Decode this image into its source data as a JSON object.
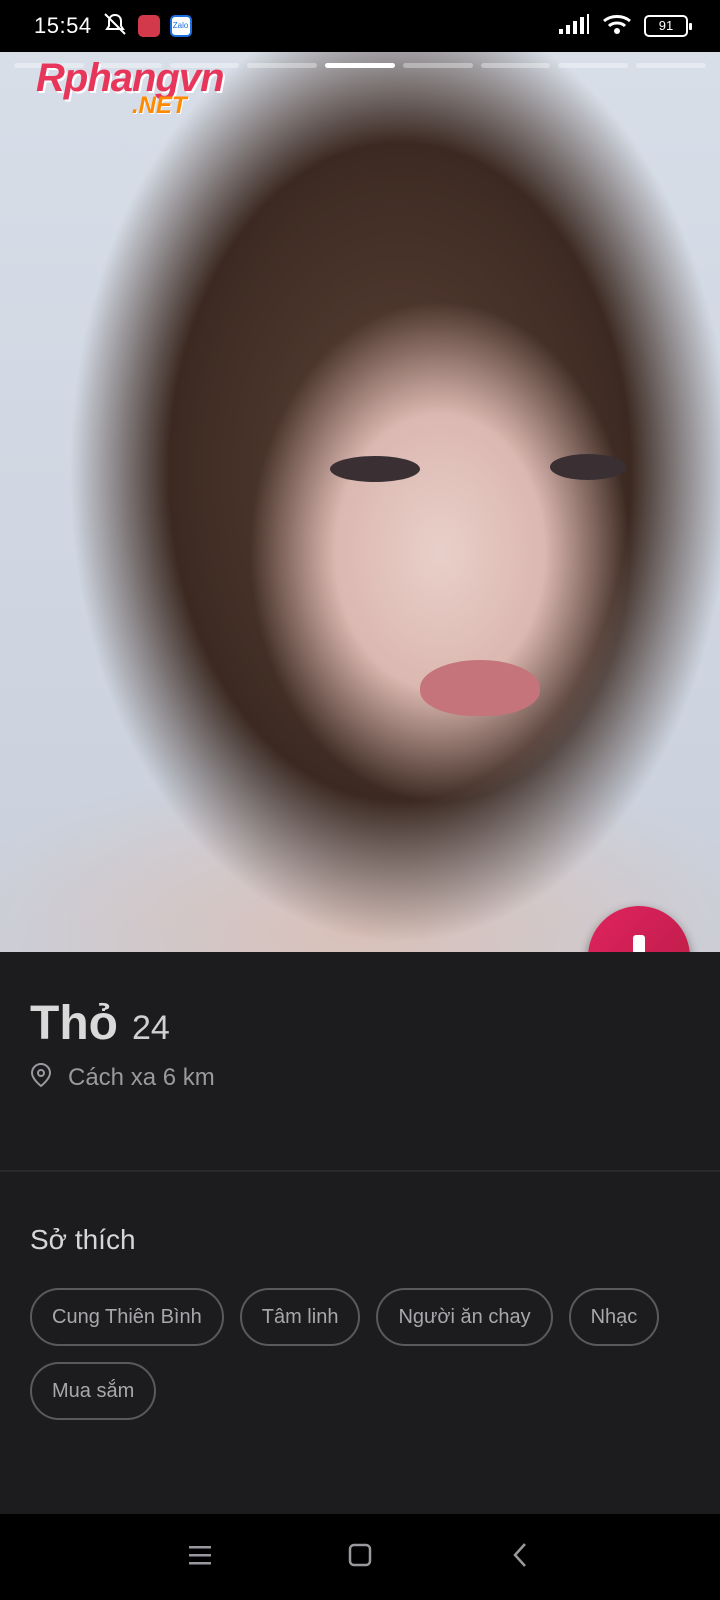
{
  "status_bar": {
    "time": "15:54",
    "battery": "91",
    "notification_icons": [
      "mute-icon",
      "app-notification-icon",
      "zalo-icon"
    ],
    "zalo_label": "Zalo"
  },
  "photo": {
    "watermark": {
      "brand": "Rphangvn",
      "suffix": ".NET"
    },
    "progress_segments": 9,
    "active_segment": 5
  },
  "profile": {
    "name": "Thỏ",
    "age": "24",
    "distance": "Cách xa 6 km"
  },
  "interests": {
    "title": "Sở thích",
    "items": [
      "Cung Thiên Bình",
      "Tâm linh",
      "Người ăn chay",
      "Nhạc",
      "Mua sắm"
    ]
  },
  "colors": {
    "accent": "#e0245e",
    "card_background": "#1c1c1e"
  },
  "nav": [
    "menu-icon",
    "home-icon",
    "back-icon"
  ]
}
